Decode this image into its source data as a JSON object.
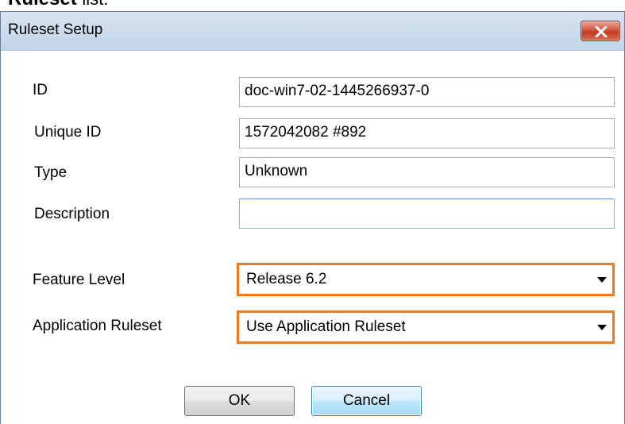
{
  "doc_heading": {
    "bold": "Ruleset",
    "rest": "list."
  },
  "window": {
    "title": "Ruleset Setup"
  },
  "fields": {
    "id": {
      "label": "ID",
      "value": "doc-win7-02-1445266937-0"
    },
    "unique_id": {
      "label": "Unique ID",
      "value": "1572042082 #892"
    },
    "type": {
      "label": "Type",
      "value": "Unknown"
    },
    "description": {
      "label": "Description",
      "value": ""
    }
  },
  "selects": {
    "feature_level": {
      "label": "Feature Level",
      "value": "Release 6.2"
    },
    "application_ruleset": {
      "label": "Application Ruleset",
      "value": "Use Application Ruleset"
    }
  },
  "buttons": {
    "ok": "OK",
    "cancel": "Cancel"
  },
  "colors": {
    "highlight": "#f07a1e",
    "title_gradient_top": "#d7e4f2",
    "close_red": "#c23b22"
  },
  "icons": {
    "close": "close-icon",
    "dropdown": "chevron-down-icon"
  }
}
